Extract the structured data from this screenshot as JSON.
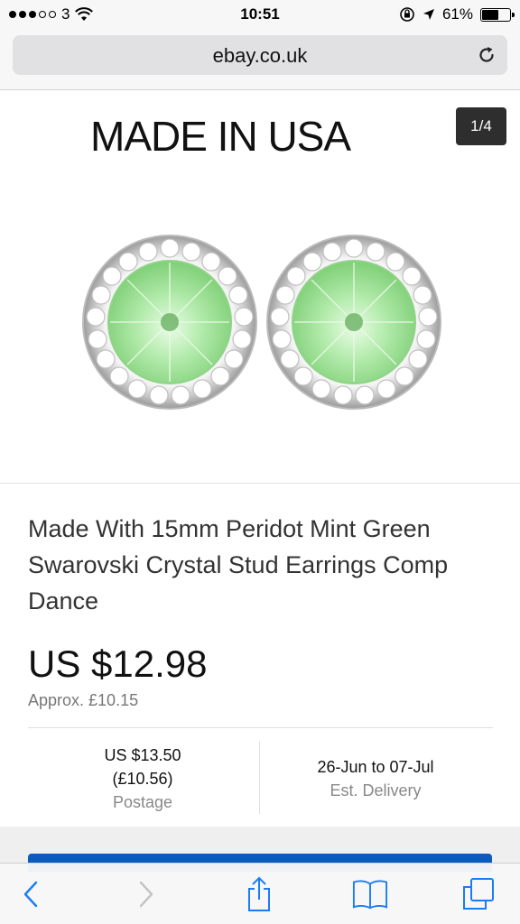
{
  "status_bar": {
    "carrier": "3",
    "time": "10:51",
    "battery": "61%",
    "battery_level": 0.61,
    "signal_bars_filled": 3,
    "signal_bars_total": 5
  },
  "browser": {
    "url": "ebay.co.uk"
  },
  "product": {
    "image_banner_text": "MADE IN USA",
    "image_counter": "1/4",
    "title": "Made With 15mm Peridot Mint Green Swarovski Crystal Stud Earrings Comp Dance",
    "price": "US $12.98",
    "approx_price": "Approx. £10.15"
  },
  "shipping": {
    "postage_usd": "US $13.50",
    "postage_gbp": "(£10.56)",
    "postage_label": "Postage",
    "delivery_range": "26-Jun to 07-Jul",
    "delivery_label": "Est. Delivery"
  },
  "colors": {
    "accent_blue": "#0b5bbf",
    "ios_blue": "#1a7cf5",
    "peridot_green": "#a9e6a2"
  }
}
